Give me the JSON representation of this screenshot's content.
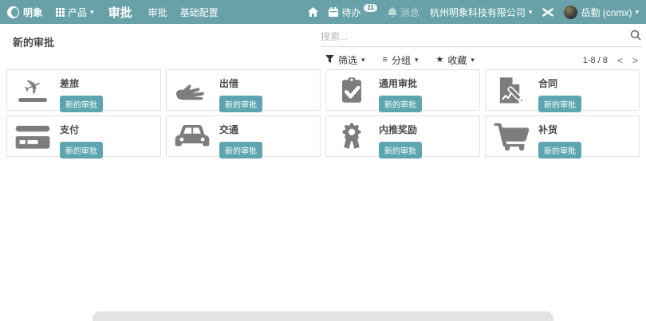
{
  "colors": {
    "navbar_teal": "#68a2a8",
    "button_teal": "#5da6b0",
    "icon_gray": "#7d7d7d"
  },
  "navbar": {
    "brand": "明象",
    "products": {
      "label": "产品"
    },
    "app_name": "审批",
    "menu_items": [
      {
        "label": "审批"
      },
      {
        "label": "基础配置"
      }
    ],
    "todo": {
      "label": "待办",
      "count": "11"
    },
    "messages": {
      "label": "消息"
    },
    "company": {
      "name": "杭州明象科技有限公司"
    },
    "user": {
      "name": "岳勤 (cnmx)"
    }
  },
  "control_panel": {
    "page_title": "新的审批",
    "search": {
      "placeholder": "搜索..."
    },
    "filter": {
      "label": "筛选"
    },
    "group_by": {
      "label": "分组"
    },
    "favorites": {
      "label": "收藏"
    },
    "pager": {
      "range": "1-8 / 8"
    }
  },
  "icons": {
    "caret": "▾",
    "star": "★",
    "bars": "≡",
    "plane": "✈",
    "chevron_left": "<",
    "chevron_right": ">"
  },
  "cards": [
    {
      "title": "差旅",
      "icon": "plane-departure-icon",
      "button_label": "新的审批"
    },
    {
      "title": "出借",
      "icon": "hand-holding-icon",
      "button_label": "新的审批"
    },
    {
      "title": "通用审批",
      "icon": "clipboard-check-icon",
      "button_label": "新的审批"
    },
    {
      "title": "合同",
      "icon": "contract-icon",
      "button_label": "新的审批"
    },
    {
      "title": "支付",
      "icon": "credit-card-icon",
      "button_label": "新的审批"
    },
    {
      "title": "交通",
      "icon": "car-icon",
      "button_label": "新的审批"
    },
    {
      "title": "内推奖励",
      "icon": "award-icon",
      "button_label": "新的审批"
    },
    {
      "title": "补货",
      "icon": "shopping-cart-icon",
      "button_label": "新的审批"
    }
  ]
}
